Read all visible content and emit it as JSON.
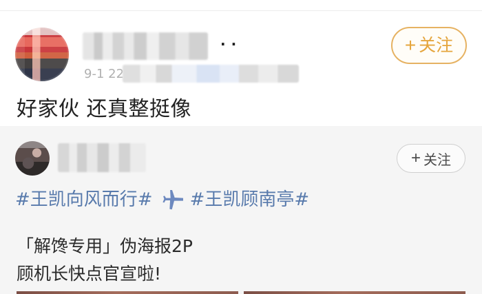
{
  "colors": {
    "background": "#ffffff",
    "quoted_background": "#f5f5f5",
    "follow_primary": "#e5a53d",
    "follow_secondary": "#4b4b4b",
    "topic": "#587aac",
    "body_text": "#222222",
    "meta_text": "#b0b0b0"
  },
  "post": {
    "user_name": "",
    "more_icon": "more-icon",
    "time": "9-1 22",
    "follow_label": "关注",
    "text": "好家伙 还真整挺像"
  },
  "quoted_post": {
    "user_name": "",
    "follow_label": "关注",
    "topic_1": "#王凯向风而行#",
    "plane_icon": "airplane-icon",
    "topic_2": "#王凯顾南亭#",
    "line_1": "「解馋专用」伪海报2P",
    "line_2": "顾机长快点官宣啦!"
  }
}
